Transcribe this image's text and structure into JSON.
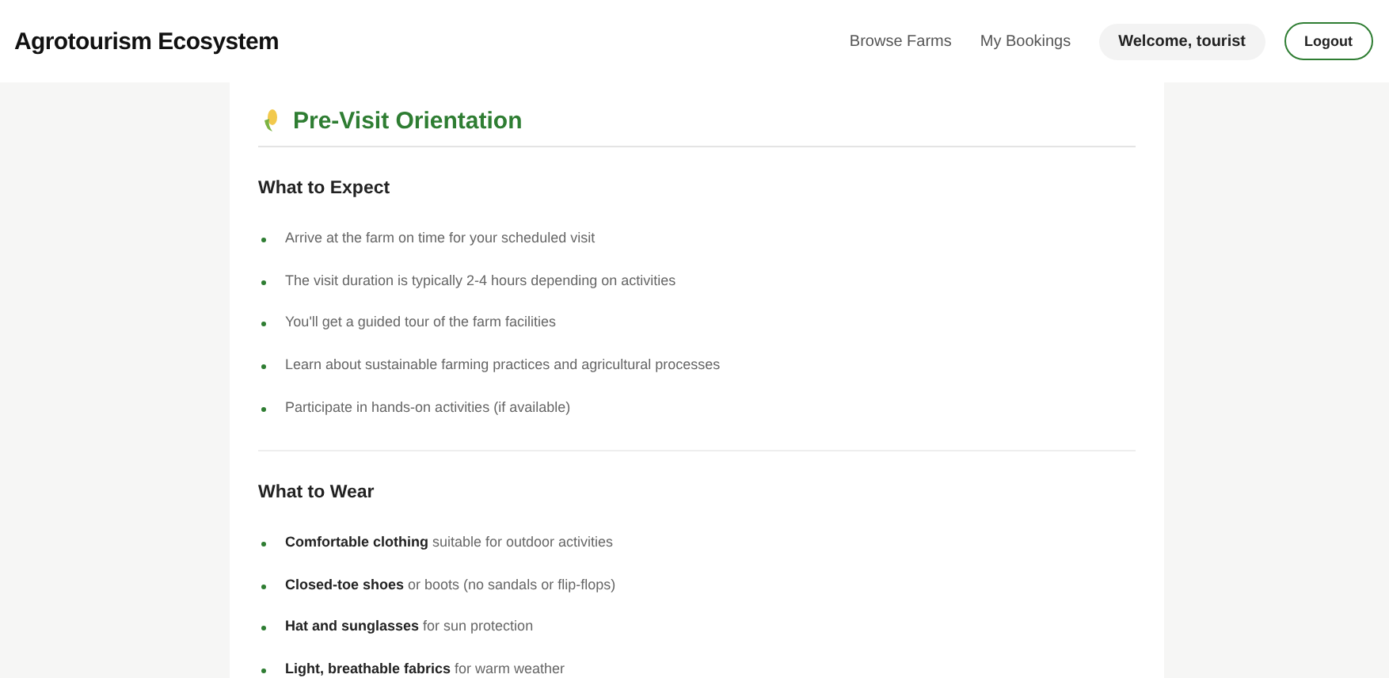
{
  "header": {
    "brand": "Agrotourism Ecosystem",
    "nav": [
      {
        "label": "Browse Farms"
      },
      {
        "label": "My Bookings"
      }
    ],
    "welcome": "Welcome, tourist",
    "logout": "Logout"
  },
  "card": {
    "title": "Pre-Visit Orientation",
    "sections": [
      {
        "heading": "What to Expect",
        "items": [
          "Arrive at the farm on time for your scheduled visit",
          "The visit duration is typically 2-4 hours depending on activities",
          "You'll get a guided tour of the farm facilities",
          "Learn about sustainable farming practices and agricultural processes",
          "Participate in hands-on activities (if available)"
        ]
      },
      {
        "heading": "What to Wear",
        "items": [
          "**Comfortable clothing** suitable for outdoor activities",
          "**Closed-toe shoes** or boots (no sandals or flip-flops)",
          "**Hat and sunglasses** for sun protection",
          "**Light, breathable fabrics** for warm weather"
        ]
      }
    ]
  }
}
